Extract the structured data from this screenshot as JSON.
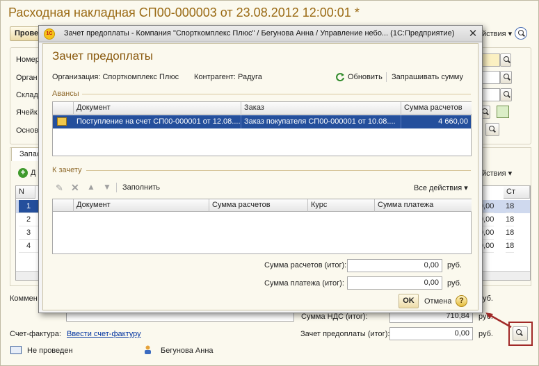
{
  "background": {
    "title": "Расходная накладная СП00-000003 от 23.08.2012 12:00:01 *",
    "toolbar": {
      "post_button": "Прове",
      "all_actions_top": "йствия ▾"
    },
    "form_labels": [
      "Номер",
      "Орган",
      "Склад",
      "Ячейк",
      "Основ"
    ],
    "tab_label": "Запас",
    "grid_toolbar": {
      "add": "Д",
      "all_actions": "йствия ▾"
    },
    "grid": {
      "col_n": "N",
      "col_tail": "Ст",
      "rows": [
        {
          "n": "1",
          "amount": "0,00",
          "tail": "18"
        },
        {
          "n": "2",
          "amount": "0,00",
          "tail": "18"
        },
        {
          "n": "3",
          "amount": "0,00",
          "tail": "18"
        },
        {
          "n": "4",
          "amount": "0,00",
          "tail": "18"
        }
      ]
    },
    "comment_label": "Коммен",
    "vat_label": "Сумма НДС (итог):",
    "vat_value": "710,84",
    "prepay_label": "Зачет предоплаты (итог):",
    "prepay_value": "0,00",
    "currency": "руб.",
    "invoice_label": "Счет-фактура:",
    "invoice_link": "Ввести счет-фактуру",
    "status": "Не проведен",
    "user": "Бегунова Анна"
  },
  "dialog": {
    "window_title": "Зачет предоплаты - Компания \"Спорткомплекс Плюс\" / Бегунова Анна / Управление небо... (1С:Предприятие)",
    "logo_text": "1С",
    "heading": "Зачет предоплаты",
    "org_label": "Организация: Спорткомплекс Плюс",
    "counterparty_label": "Контрагент: Радуга",
    "refresh_label": "Обновить",
    "request_label": "Запрашивать сумму",
    "advances_section": "Авансы",
    "advances_table": {
      "columns": [
        "Документ",
        "Заказ",
        "Сумма расчетов"
      ],
      "rows": [
        {
          "doc": "Поступление на счет СП00-000001 от 12.08....",
          "order": "Заказ покупателя СП00-000001 от 10.08....",
          "amount": "4 660,00"
        }
      ]
    },
    "offset_section": "К зачету",
    "fill_label": "Заполнить",
    "all_actions": "Все действия ▾",
    "offset_table": {
      "columns": [
        "Документ",
        "Сумма расчетов",
        "Курс",
        "Сумма платежа"
      ]
    },
    "total_settlement_label": "Сумма расчетов (итог):",
    "total_settlement_value": "0,00",
    "total_payment_label": "Сумма платежа (итог):",
    "total_payment_value": "0,00",
    "currency": "руб.",
    "ok_label": "OK",
    "cancel_label": "Отмена",
    "help_label": "?"
  },
  "colors": {
    "accent": "#9a6a14",
    "selection": "#244f9c",
    "highlight": "#a12a28"
  }
}
